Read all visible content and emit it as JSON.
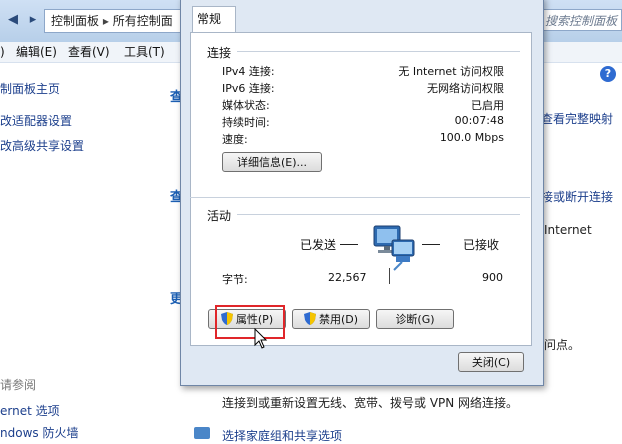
{
  "background_window": {
    "address": {
      "crumb1": "控制面板",
      "crumb2": "所有控制面",
      "search_placeholder": "搜索控制面板"
    },
    "menu": [
      "编辑(E)",
      "查看(V)",
      "工具(T)"
    ],
    "menu_fragment": ")",
    "left_links": [
      "制面板主页",
      "改适配器设置",
      "改高级共享设置"
    ],
    "see_also_title": "请参阅",
    "see_also_links": [
      "ernet 选项",
      "ndows 防火墙"
    ],
    "right_fragments": {
      "view_full_map": "查看完整映射",
      "connect_disconnect": "接或断开连接",
      "internet": "Internet",
      "access_point": "问点。",
      "setup_text": "连接到或重新设置无线、宽带、拨号或 VPN 网络连接。",
      "homegroup": "选择家庭组和共享选项",
      "heading_frag_1": "查",
      "heading_frag_2": "查",
      "heading_frag_3": "更"
    }
  },
  "dialog": {
    "tab": "常规",
    "connection_group": "连接",
    "fields": [
      {
        "label": "IPv4 连接:",
        "value": "无 Internet 访问权限"
      },
      {
        "label": "IPv6 连接:",
        "value": "无网络访问权限"
      },
      {
        "label": "媒体状态:",
        "value": "已启用"
      },
      {
        "label": "持续时间:",
        "value": "00:07:48"
      },
      {
        "label": "速度:",
        "value": "100.0 Mbps"
      }
    ],
    "details_button": "详细信息(E)...",
    "activity_group": "活动",
    "sent_label": "已发送",
    "received_label": "已接收",
    "bytes_label": "字节:",
    "bytes_sent": "22,567",
    "bytes_received": "900",
    "properties_button": "属性(P)",
    "disable_button": "禁用(D)",
    "diagnose_button": "诊断(G)",
    "close_button": "关闭(C)"
  },
  "colors": {
    "highlight": "#e0262a",
    "link": "#1c3f8c"
  }
}
